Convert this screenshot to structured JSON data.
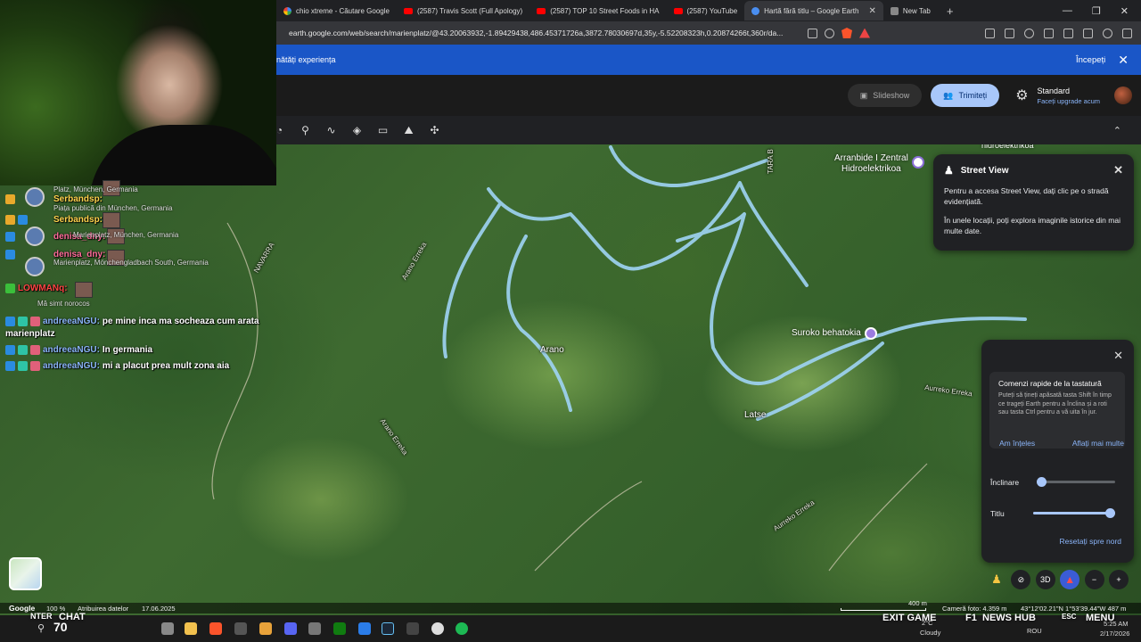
{
  "browser": {
    "tabs": [
      {
        "label": "chio xtreme - Căutare Google",
        "icon": "google-icon"
      },
      {
        "label": "(2587) Travis Scott (Full Apology)",
        "icon": "youtube-icon"
      },
      {
        "label": "(2587) TOP 10 Street Foods in HA",
        "icon": "youtube-icon"
      },
      {
        "label": "(2587) YouTube",
        "icon": "youtube-icon"
      },
      {
        "label": "Hartă fără titlu – Google Earth",
        "icon": "earth-icon",
        "active": true
      },
      {
        "label": "New Tab",
        "icon": "shield-icon"
      }
    ],
    "url": "earth.google.com/web/search/marienplatz/@43.20063932,-1.89429438,486.45371726a,3872.78030697d,35y,-5.52208323h,0.20874266t,360r/da..."
  },
  "banner": {
    "text": "nătăți experiența",
    "start_label": "Începeți"
  },
  "earth_header": {
    "slideshow_label": "Slideshow",
    "share_label": "Trimiteți",
    "plan_title": "Standard",
    "plan_upgrade": "Faceți upgrade acum"
  },
  "map": {
    "labels": {
      "arrano": "Arano",
      "latse": "Latse",
      "suroko": "Suroko behatokia",
      "arranbide": "Arranbide I Zentral",
      "hidroelektrikoa": "Hidroelektrikoa",
      "hidro_top": "hidroelektrikoa",
      "navarra": "NAVARRA",
      "tara": "TARA B",
      "arano_erreka1": "Arano Erreka",
      "arano_erreka2": "Arano Erreka",
      "aurreko_erreka1": "Aurreko Erreka",
      "aurreko_erreka2": "Aurreko Erreka"
    }
  },
  "street_view": {
    "title": "Street View",
    "text1": "Pentru a accesa Street View, dați clic pe o stradă evidențiată.",
    "text2": "În unele locații, poți explora imaginile istorice din mai multe date."
  },
  "shortcuts": {
    "title": "Comenzi rapide de la tastatură",
    "desc": "Puteți să țineți apăsată tasta Shift în timp ce trageți Earth pentru a înclina și a roti sau tasta Ctrl pentru a vă uita în jur.",
    "got_it": "Am înțeles",
    "learn_more": "Aflați mai multe",
    "tilt_label": "Înclinare",
    "tilt_value": 0.0,
    "title_label": "Titlu",
    "title_value": 1.0,
    "reset_label": "Resetați spre nord"
  },
  "map_controls": {
    "three_d": "3D",
    "minus": "−",
    "plus": "+"
  },
  "status": {
    "google": "Google",
    "zoom": "100 %",
    "attribution": "Atribuirea datelor",
    "date": "17.06.2025",
    "scale": "400 m",
    "camera": "Cameră foto: 4.359 m",
    "coords": "43°12'02.21\"N 1°53'39.44\"W  487 m"
  },
  "chat": {
    "lines": [
      {
        "user": "Serbandsp:",
        "sub": "Platz, München, Germania"
      },
      {
        "user": "Serbandsp:",
        "sub": "Piața publică din München, Germania"
      },
      {
        "user": "denisa_dny:",
        "sub": "Marienplatz, München, Germania"
      },
      {
        "user": "denisa_dny:",
        "sub": "Marienplatz, Mönchengladbach South, Germania"
      },
      {
        "user": "LOWMANq:",
        "sub": "Mă simt norocos"
      },
      {
        "user": "andreeaNGU:",
        "msg": "pe mine inca ma socheaza cum arata",
        "msg2": "marienplatz"
      },
      {
        "user": "andreeaNGU:",
        "msg": "In germania"
      },
      {
        "user": "andreeaNGU:",
        "msg": "mi a placut prea mult zona aia"
      }
    ]
  },
  "taskbar": {
    "score": "70",
    "exit_game": "EXIT GAME",
    "news_hub": "NEWS HUB",
    "menu": "MENU",
    "f1": "F1",
    "esc": "ESC",
    "chat": "CHAT",
    "enter": "NTER",
    "weather": "Cloudy",
    "temp": "2°C",
    "lang": "ROU",
    "time": "5:25 AM",
    "date": "2/17/2026"
  },
  "colors": {
    "banner": "#1a56c7",
    "share_pill": "#a8c7fa",
    "street_highlight": "#9fd4f5",
    "link": "#8ab4f8"
  }
}
